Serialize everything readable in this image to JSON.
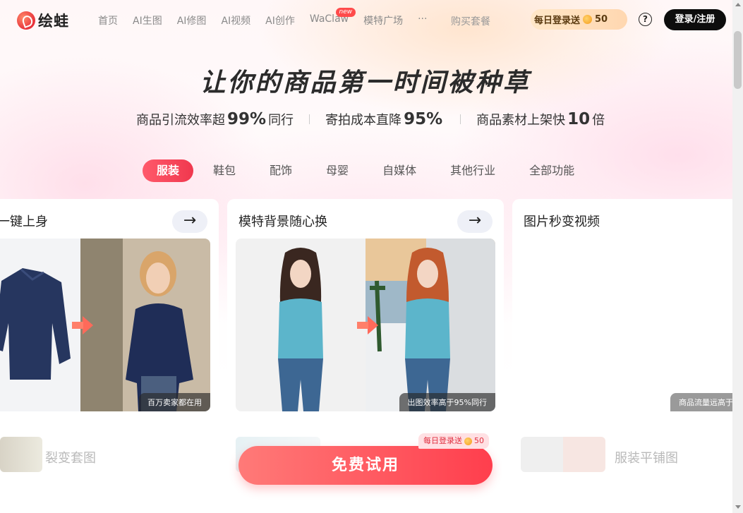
{
  "header": {
    "logo_text": "绘蛙",
    "nav": [
      "首页",
      "AI生图",
      "AI修图",
      "AI视频",
      "AI创作",
      "WaClaw",
      "模特广场",
      "···"
    ],
    "nav_badge": "new",
    "buy": "购买套餐",
    "daily_bonus": "每日登录送",
    "daily_points": "50",
    "help": "?",
    "login": "登录/注册"
  },
  "hero": {
    "title": "让你的商品第一时间被种草",
    "stats": [
      {
        "label": "商品引流效率超",
        "value": "99%",
        "suffix": "同行"
      },
      {
        "label": "寄拍成本直降",
        "value": "95%",
        "suffix": ""
      },
      {
        "label": "商品素材上架快",
        "value": "10",
        "suffix": "倍"
      }
    ]
  },
  "tabs": [
    "服装",
    "鞋包",
    "配饰",
    "母婴",
    "自媒体",
    "其他行业",
    "全部功能"
  ],
  "cards": [
    {
      "title": "一键上身",
      "caption": "百万卖家都在用"
    },
    {
      "title": "模特背景随心换",
      "caption": "出图效率高于95%同行"
    },
    {
      "title": "图片秒变视频",
      "caption": "商品流量远高于"
    }
  ],
  "bottom_cards": [
    "裂变套图",
    "",
    "服装平铺图"
  ],
  "cta": {
    "label": "免费试用",
    "badge": "每日登录送",
    "badge_points": "50"
  },
  "colors": {
    "accent": "#f0384e",
    "login_bg": "#0d0d0d",
    "caption_bg": "#282828"
  }
}
